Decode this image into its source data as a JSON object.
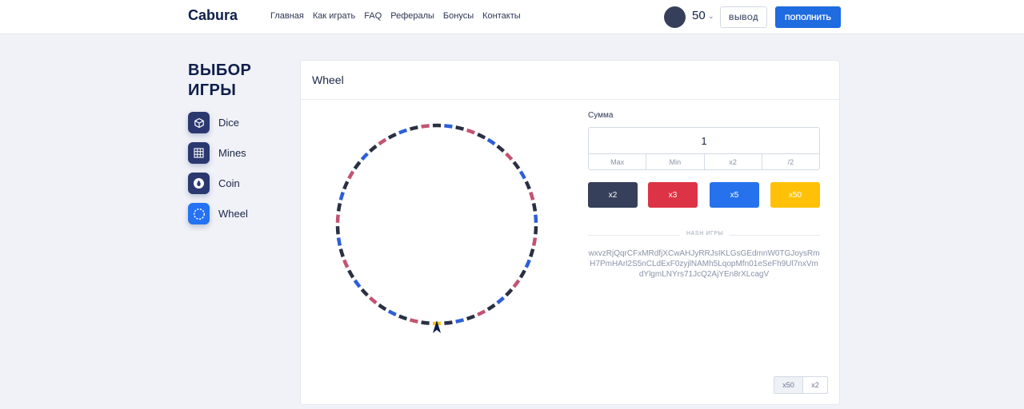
{
  "header": {
    "logo": "Cabura",
    "nav": [
      "Главная",
      "Как играть",
      "FAQ",
      "Рефералы",
      "Бонусы",
      "Контакты"
    ],
    "balance": "50",
    "withdraw_label": "ВЫВОД",
    "deposit_label": "ПОПОЛНИТЬ"
  },
  "sidebar": {
    "title_line1": "ВЫБОР",
    "title_line2": "ИГРЫ",
    "games": [
      {
        "label": "Dice",
        "icon": "cube-icon"
      },
      {
        "label": "Mines",
        "icon": "grid-icon"
      },
      {
        "label": "Coin",
        "icon": "coin-icon"
      },
      {
        "label": "Wheel",
        "icon": "wheel-icon",
        "active": true
      }
    ]
  },
  "game": {
    "title": "Wheel",
    "sum_label": "Сумма",
    "sum_value": "1",
    "sum_buttons": [
      "Max",
      "Min",
      "x2",
      "/2"
    ],
    "bets": [
      {
        "label": "x2",
        "color": "#36405a"
      },
      {
        "label": "x3",
        "color": "#dd3346"
      },
      {
        "label": "x5",
        "color": "#2672ec"
      },
      {
        "label": "x50",
        "color": "#ffc107"
      }
    ],
    "hash_label": "HASH ИГРЫ",
    "hash": "wxvzRjQqrCFxMRdfjXCwAHJyRRJsIKLGsGEdmnW0TGJoysRmH7PmHArl2S5nCLdExF0zyjlNAMh5LqopMfn01eSeFh9Ul7nxVmdYlgmLNYrs71JcQ2AjYEn8rXLcagV",
    "history": [
      "x50",
      "x2"
    ]
  },
  "wheel_colors": {
    "dark": "#2a3044",
    "red": "#c25472",
    "blue": "#2d5fd6",
    "gold": "#f5c518"
  }
}
